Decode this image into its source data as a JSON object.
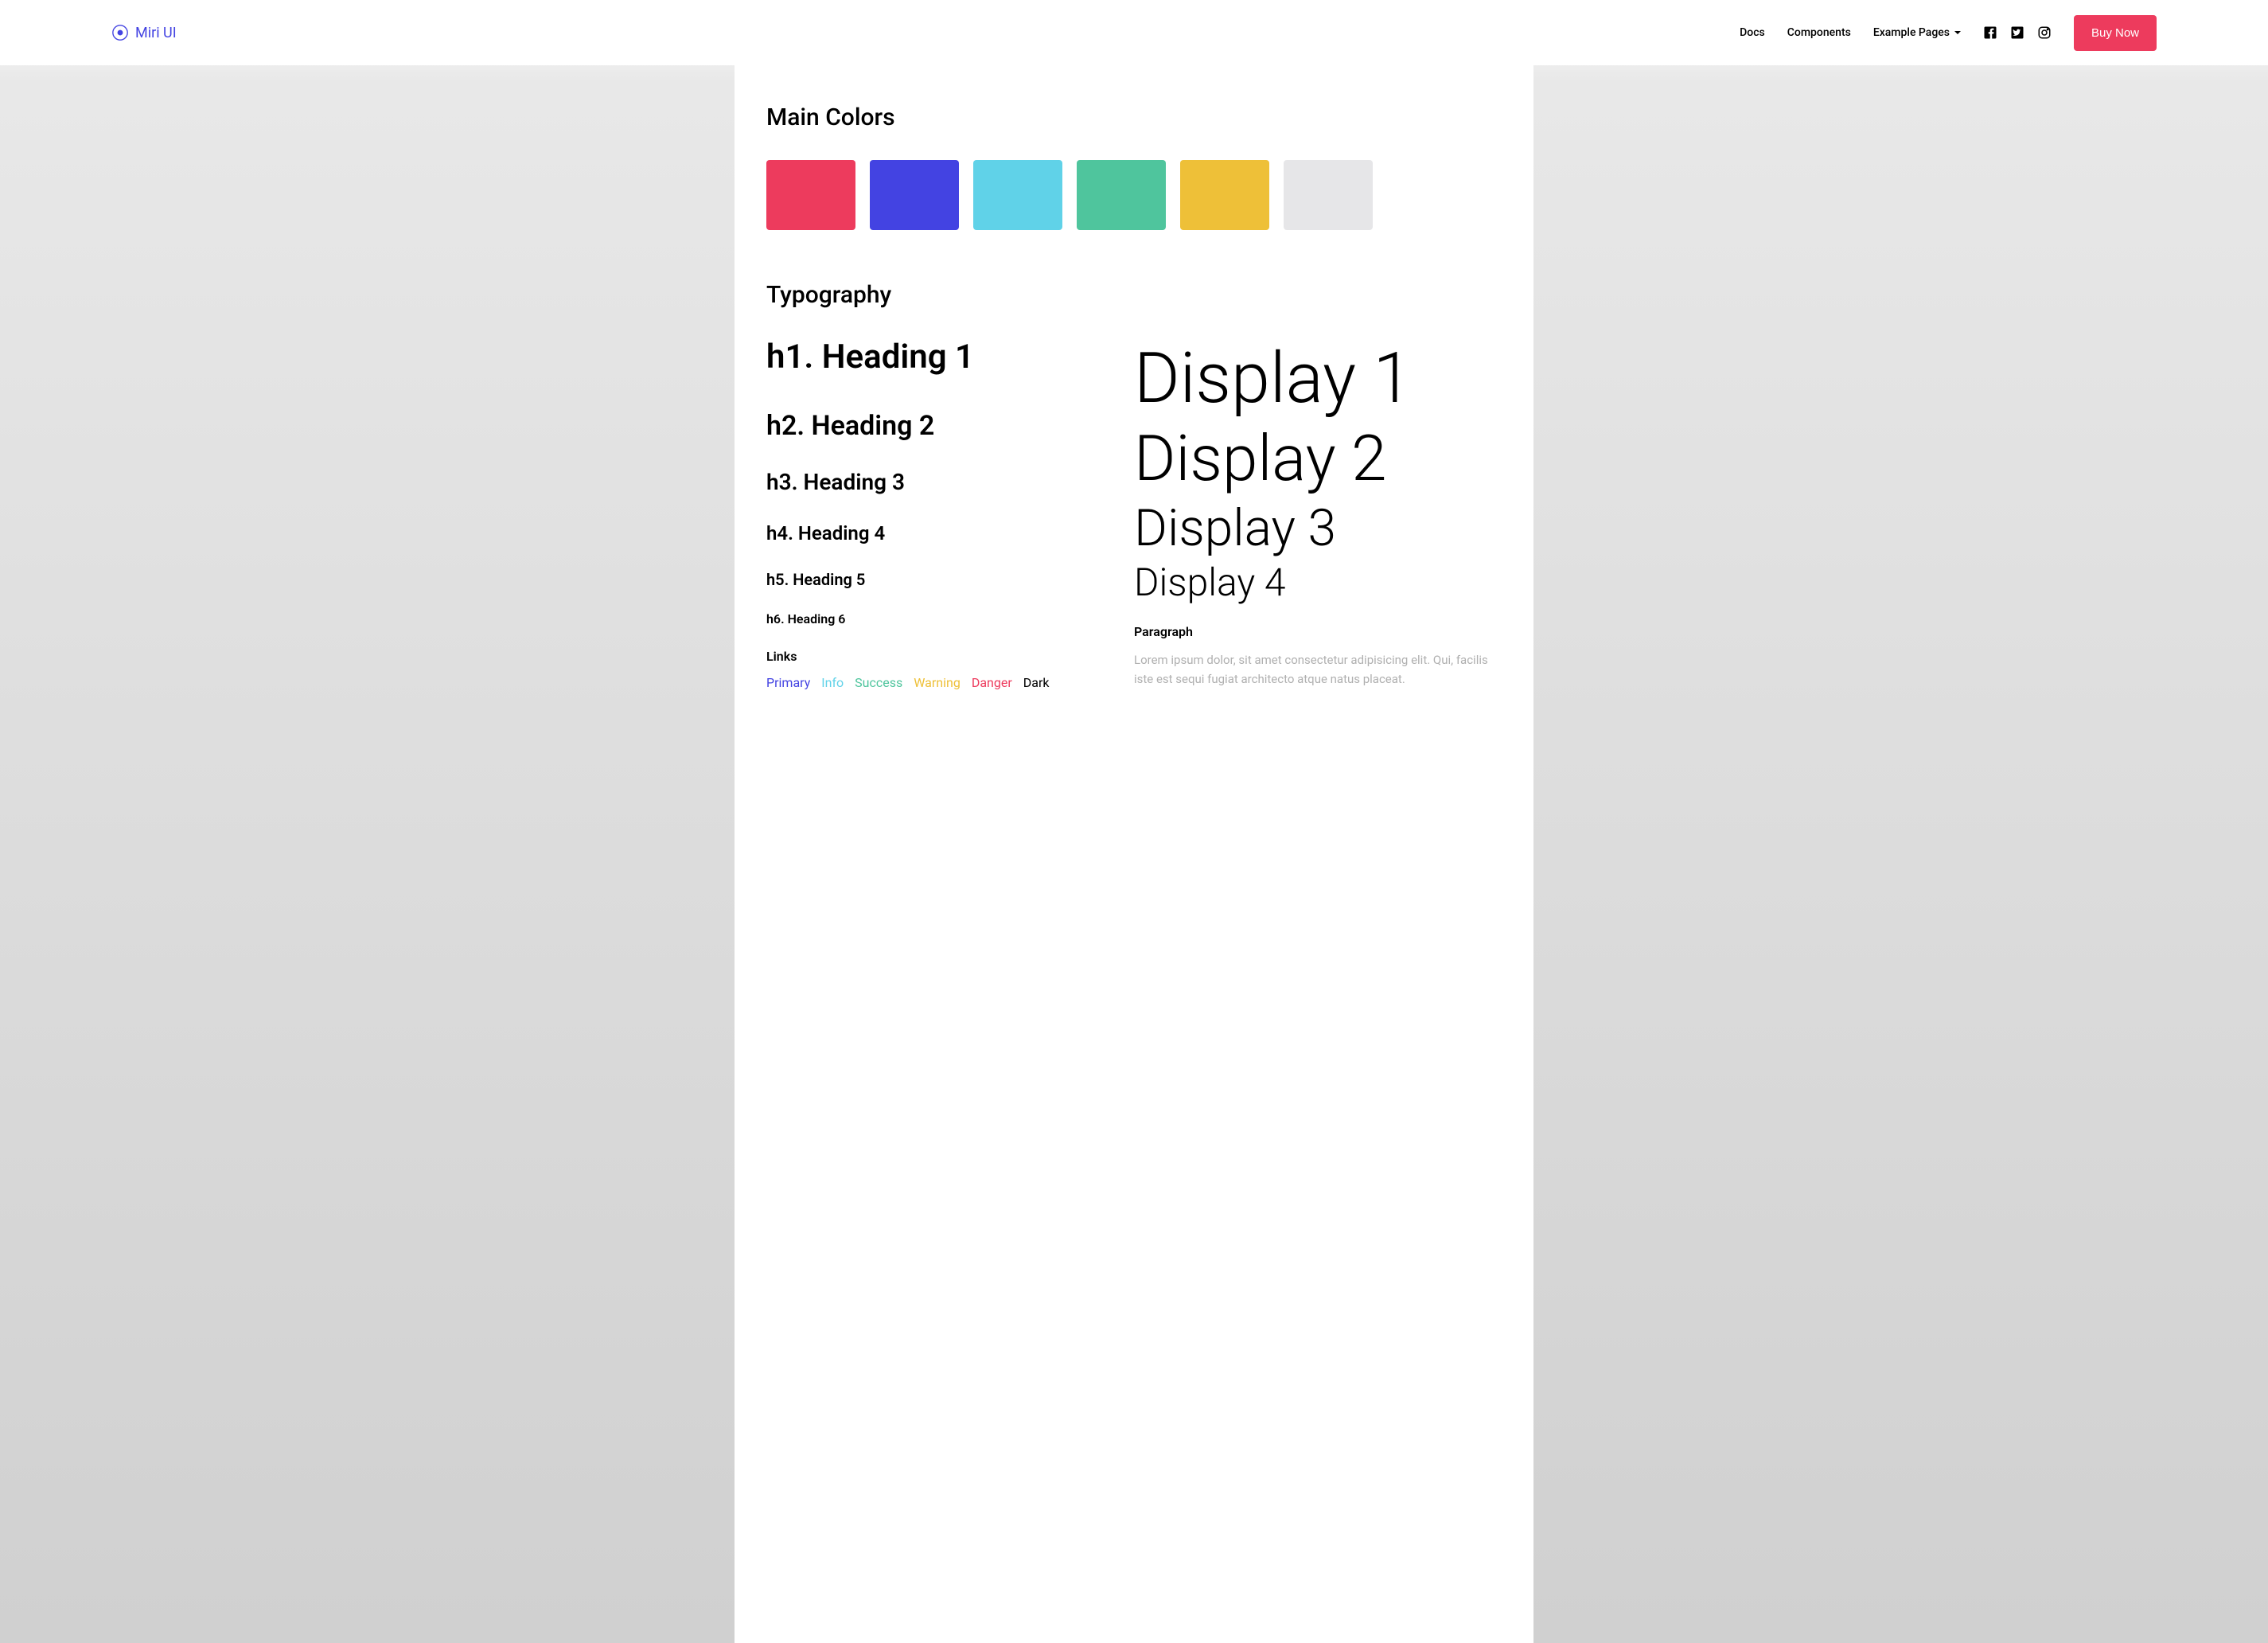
{
  "brand": {
    "name": "Miri UI"
  },
  "nav": {
    "docs": "Docs",
    "components": "Components",
    "examplePages": "Example Pages",
    "buyNow": "Buy Now"
  },
  "sections": {
    "mainColors": "Main Colors",
    "typography": "Typography"
  },
  "colors": {
    "c1": "#ed3b5d",
    "c2": "#4343e2",
    "c3": "#60d2e8",
    "c4": "#4fc59d",
    "c5": "#eec038",
    "c6": "#e6e6e8"
  },
  "typography": {
    "h1": "h1. Heading 1",
    "h2": "h2. Heading 2",
    "h3": "h3. Heading 3",
    "h4": "h4. Heading 4",
    "h5": "h5. Heading 5",
    "h6": "h6. Heading 6",
    "display1": "Display 1",
    "display2": "Display 2",
    "display3": "Display 3",
    "display4": "Display 4",
    "linksTitle": "Links",
    "paragraphTitle": "Paragraph",
    "paragraphText": "Lorem ipsum dolor, sit amet consectetur adipisicing elit. Qui, facilis iste est sequi fugiat architecto atque natus placeat."
  },
  "links": {
    "primary": "Primary",
    "info": "Info",
    "success": "Success",
    "warning": "Warning",
    "danger": "Danger",
    "dark": "Dark"
  }
}
